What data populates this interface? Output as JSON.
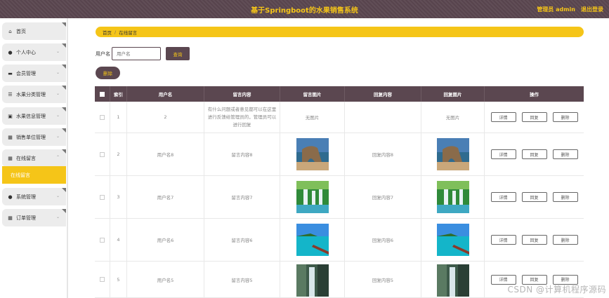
{
  "header": {
    "title": "基于Springboot的水果销售系统",
    "user": "管理员 admin",
    "logout": "退出登录"
  },
  "sidebar": {
    "items": [
      {
        "label": "首页",
        "icon": "home-icon"
      },
      {
        "label": "个人中心",
        "icon": "user-icon"
      },
      {
        "label": "会员管理",
        "icon": "monitor-icon"
      },
      {
        "label": "水果分类管理",
        "icon": "sliders-icon"
      },
      {
        "label": "水果信息管理",
        "icon": "clipboard-icon"
      },
      {
        "label": "销售单位管理",
        "icon": "grid-icon"
      },
      {
        "label": "在线留言",
        "icon": "grid-icon"
      },
      {
        "label": "系统管理",
        "icon": "user-icon"
      },
      {
        "label": "订单管理",
        "icon": "grid-icon"
      }
    ],
    "active_sub": "在线留言"
  },
  "breadcrumb": {
    "home": "首页",
    "separator": "/",
    "current": "在线留言"
  },
  "search": {
    "label": "用户名",
    "placeholder": "用户名",
    "button": "查询"
  },
  "toolbar": {
    "delete": "删除"
  },
  "table": {
    "columns": [
      "",
      "索引",
      "用户名",
      "留言内容",
      "留言图片",
      "回复内容",
      "回复图片",
      "操作"
    ],
    "rows": [
      {
        "index": "1",
        "username": "2",
        "message": "有什么问题或者意见都可以在这里进行反馈给管理员的，管理员可以进行回复",
        "msg_image": "无图片",
        "reply": "",
        "reply_image": "无图片"
      },
      {
        "index": "2",
        "username": "用户名8",
        "message": "留言内容8",
        "msg_image": "image:beach-arch",
        "reply": "回复内容8",
        "reply_image": "image:beach-arch"
      },
      {
        "index": "3",
        "username": "用户名7",
        "message": "留言内容7",
        "msg_image": "image:waterfall-green",
        "reply": "回复内容7",
        "reply_image": "image:waterfall-green"
      },
      {
        "index": "4",
        "username": "用户名6",
        "message": "留言内容6",
        "msg_image": "image:pier-sea",
        "reply": "回复内容6",
        "reply_image": "image:pier-sea"
      },
      {
        "index": "5",
        "username": "用户名5",
        "message": "留言内容5",
        "msg_image": "image:waterfall-cliff",
        "reply": "回复内容5",
        "reply_image": "image:waterfall-cliff"
      }
    ],
    "actions": [
      "详情",
      "回复",
      "删除"
    ]
  },
  "watermark": "CSDN @计算机程序源码",
  "colors": {
    "header_bg": "#5b4750",
    "accent": "#f5c518",
    "sidebar_item_bg": "#ececec"
  }
}
